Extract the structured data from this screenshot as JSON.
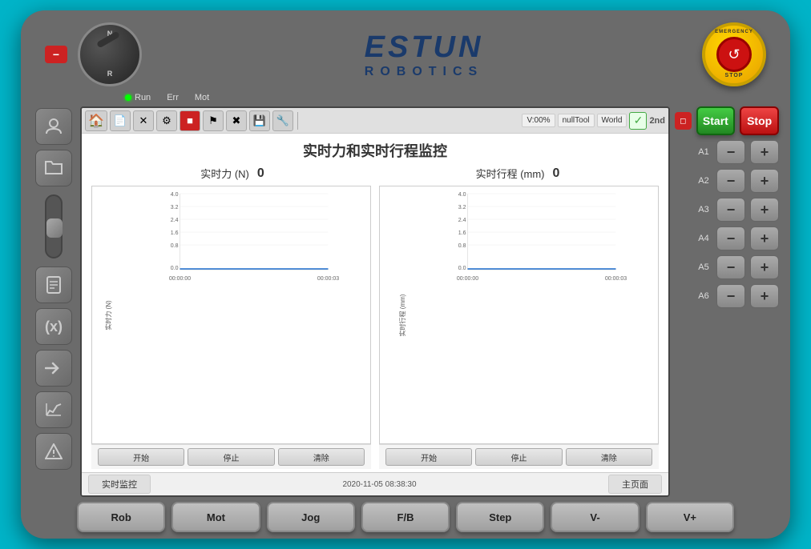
{
  "device": {
    "brand": "ESTUN",
    "subtitle": "ROBOTICS"
  },
  "status": {
    "run_label": "Run",
    "err_label": "Err",
    "mot_label": "Mot"
  },
  "toolbar": {
    "info1": "V:00%",
    "info2": "nullTool",
    "info3": "World",
    "right_label": "2nd"
  },
  "screen": {
    "title": "实时力和实时行程监控",
    "force_label": "实时力 (N)",
    "force_value": "0",
    "travel_label": "实时行程 (mm)",
    "travel_value": "0",
    "chart1_ylabel": "实时力 (N)",
    "chart2_ylabel": "实时行程 (mm)",
    "y_ticks": [
      "4.0",
      "3.2",
      "2.4",
      "1.6",
      "0.8",
      "0.0"
    ],
    "x_ticks": [
      "00:00:00",
      "00:00:03"
    ],
    "chart_btn1": "开始",
    "chart_btn2": "停止",
    "chart_btn3": "清除",
    "timestamp": "2020-11-05 08:38:30",
    "bottom_tab1": "实时监控",
    "bottom_tab2": "主页面"
  },
  "controls": {
    "start_label": "Start",
    "stop_label": "Stop",
    "axes": [
      "A1",
      "A2",
      "A3",
      "A4",
      "A5",
      "A6"
    ],
    "plus_label": "+",
    "minus_label": "−"
  },
  "bottom_buttons": [
    "Rob",
    "Mot",
    "Jog",
    "F/B",
    "Step",
    "V-",
    "V+"
  ],
  "sidebar_icons": [
    "user",
    "folder",
    "document",
    "formula",
    "arrow",
    "graph",
    "warning"
  ]
}
